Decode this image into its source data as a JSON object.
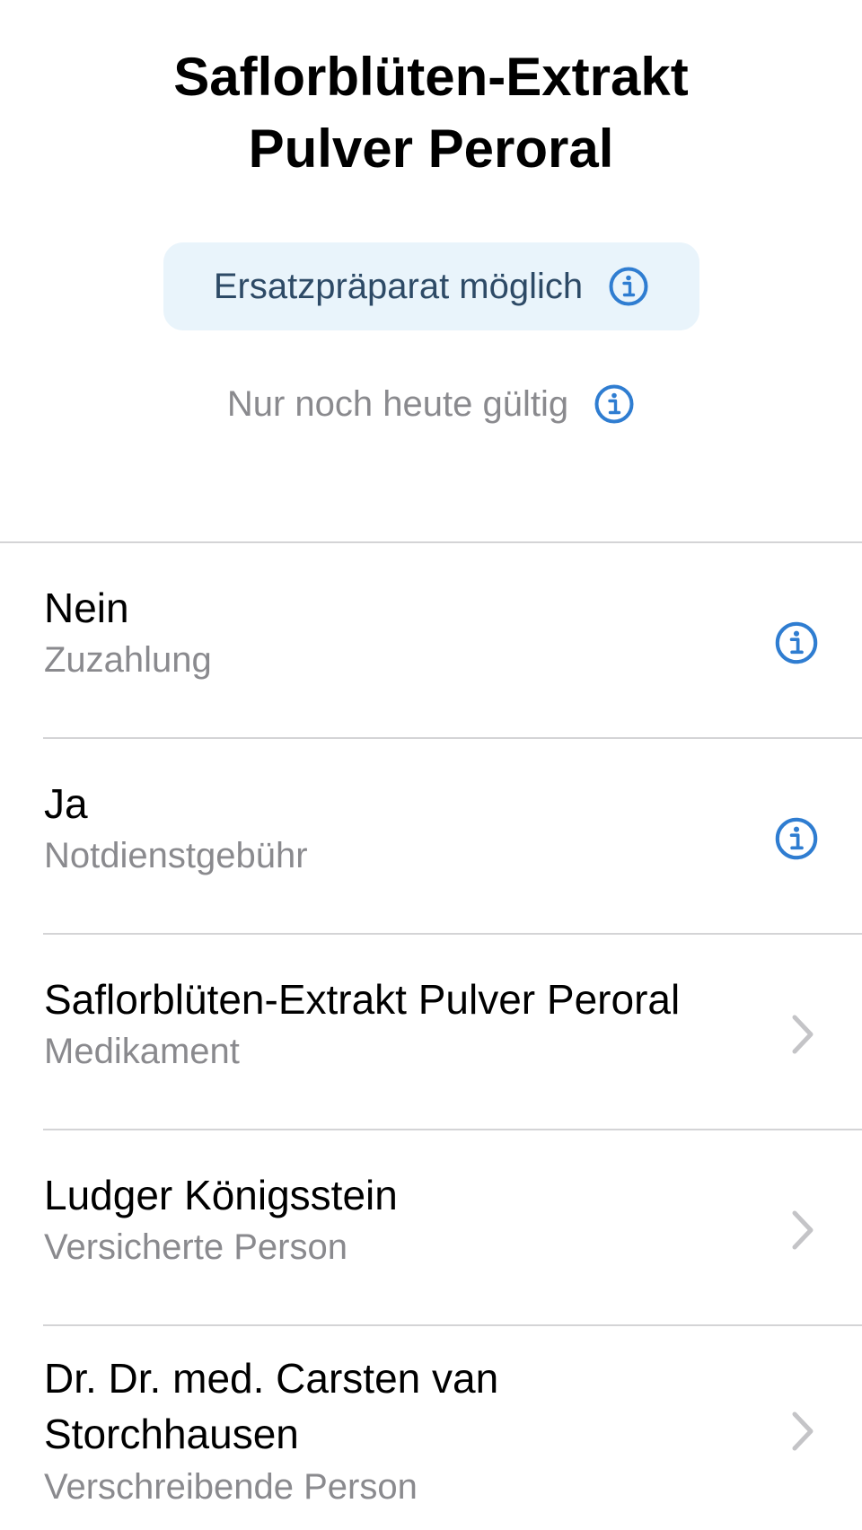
{
  "header": {
    "title_line1": "Saflorblüten-Extrakt",
    "title_line2": "Pulver Peroral"
  },
  "substitution_chip": {
    "label": "Ersatzpräparat möglich",
    "icon": "info-circle-icon"
  },
  "validity": {
    "label": "Nur noch heute gültig",
    "icon": "info-circle-icon"
  },
  "rows": [
    {
      "value": "Nein",
      "label": "Zuzahlung",
      "accessory": "info-circle-icon"
    },
    {
      "value": "Ja",
      "label": "Notdienstgebühr",
      "accessory": "info-circle-icon"
    },
    {
      "value": "Saflorblüten-Extrakt Pulver Peroral",
      "label": "Medikament",
      "accessory": "chevron-right-icon"
    },
    {
      "value": "Ludger Königsstein",
      "label": "Versicherte Person",
      "accessory": "chevron-right-icon"
    },
    {
      "value_line1": "Dr. Dr. med. Carsten van",
      "value_line2": "Storchhausen",
      "label": "Verschreibende Person",
      "accessory": "chevron-right-icon"
    }
  ],
  "colors": {
    "accent": "#2f7dd1",
    "chip_background": "#e9f4fb",
    "secondary_text": "#8a8a8e",
    "separator": "#d4d4d6",
    "chevron": "#c4c4c7"
  }
}
